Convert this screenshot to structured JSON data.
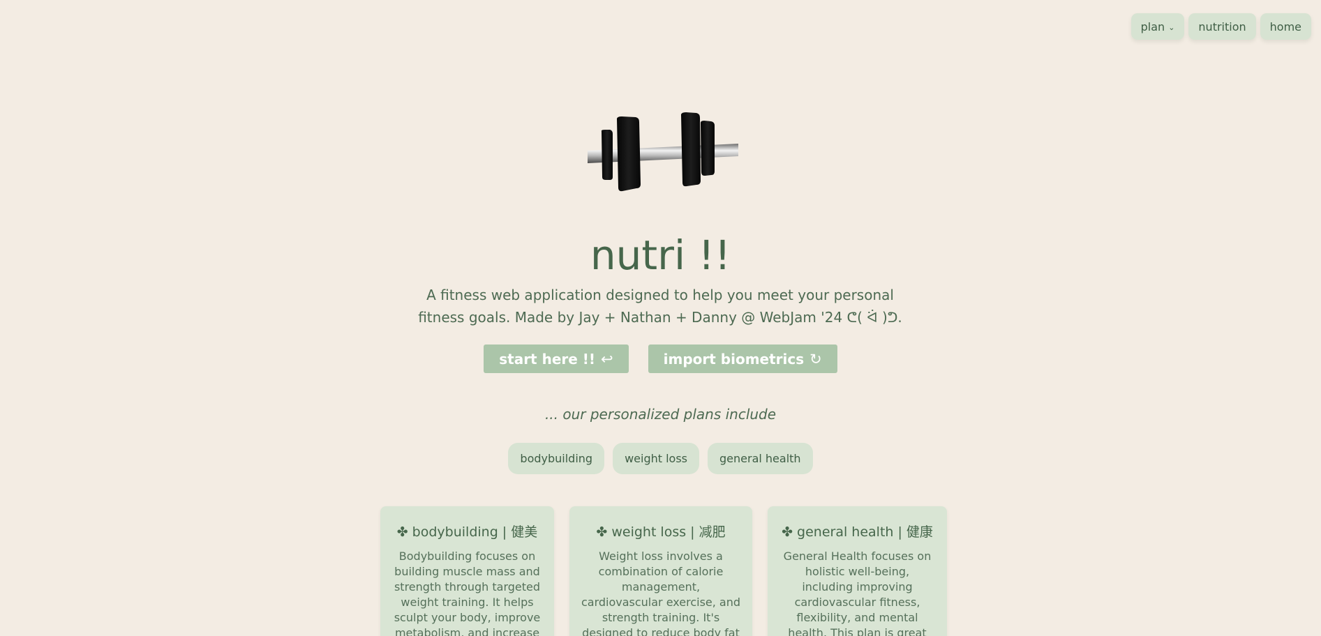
{
  "nav": {
    "plan_label": "plan",
    "plan_chevron_icon": "chevron-down",
    "nutrition_label": "nutrition",
    "home_label": "home"
  },
  "hero": {
    "image_icon": "dumbbell",
    "title": "nutri !!",
    "subtitle": "A fitness web application designed to help you meet your personal fitness goals. Made by Jay + Nathan + Danny @ WebJam '24 ᕦ( ᐛ )ᕤ."
  },
  "actions": {
    "start_label": "start here !!",
    "start_icon": "↩",
    "import_label": "import biometrics",
    "import_icon": "↻"
  },
  "plans": {
    "caption": "... our personalized plans include",
    "tags": [
      "bodybuilding",
      "weight loss",
      "general health"
    ]
  },
  "cards": [
    {
      "title": "✤ bodybuilding | 健美",
      "body": "Bodybuilding focuses on building muscle mass and strength through targeted weight training. It helps sculpt your body, improve metabolism, and increase"
    },
    {
      "title": "✤ weight loss | 减肥",
      "body": "Weight loss involves a combination of calorie management, cardiovascular exercise, and strength training. It's designed to reduce body fat and improve"
    },
    {
      "title": "✤ general health | 健康",
      "body": "General Health focuses on holistic well-being, including improving cardiovascular fitness, flexibility, and mental health. This plan is great for"
    }
  ],
  "colors": {
    "background": "#f3ece3",
    "accent_green": "#abc5a9",
    "pill_green": "#d7e3d2",
    "text_green": "#46664b"
  }
}
